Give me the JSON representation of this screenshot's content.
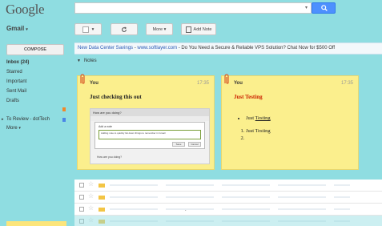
{
  "header": {
    "logo": "Google",
    "search_placeholder": "",
    "search_caret": "▾"
  },
  "sidebar": {
    "app_label": "Gmail",
    "compose": "COMPOSE",
    "items": [
      {
        "label": "Inbox (24)",
        "bold": true
      },
      {
        "label": "Starred"
      },
      {
        "label": "Important"
      },
      {
        "label": "Sent Mail"
      },
      {
        "label": "Drafts"
      }
    ],
    "label_item": "To Review - dotTech",
    "more": "More",
    "label_colors": {
      "orange": "#f0882a",
      "blue": "#4986e7"
    }
  },
  "toolbar": {
    "more": "More",
    "add_note": "Add Note"
  },
  "ad": {
    "title": "New Data Center Savings",
    "sep": " - ",
    "url": "www.softlayer.com",
    "desc": " - Do You Need a Secure & Reliable VPS Solution? Chat Now for $500 Off"
  },
  "notes_section": {
    "label": "Notes",
    "notes": [
      {
        "author": "You",
        "time": "17:35",
        "title": "Just checking this out",
        "screenshot": {
          "bar_title": "How are you doing?",
          "dialog_label": "Add a note",
          "field_text": "Adding note to quickly list down things to remember in Gmail",
          "btn_ok": "Save",
          "btn_cancel": "Cancel",
          "caption": "How are you doing?"
        }
      },
      {
        "author": "You",
        "time": "17:35",
        "title": "Just Testing",
        "bullets": [
          {
            "prefix": "Just ",
            "underlined": "Testing"
          }
        ],
        "numbered": [
          "Just Testing",
          ""
        ]
      }
    ]
  },
  "rows": [
    {
      "dot": ""
    },
    {
      "dot": ""
    },
    {
      "dot": "."
    },
    {
      "dot": ""
    }
  ],
  "colors": {
    "background": "#8fdde1",
    "note": "#fbef8d",
    "search_button": "#4d90fe",
    "ad_link": "#2a59b5",
    "note_title_red": "#cc2200"
  }
}
